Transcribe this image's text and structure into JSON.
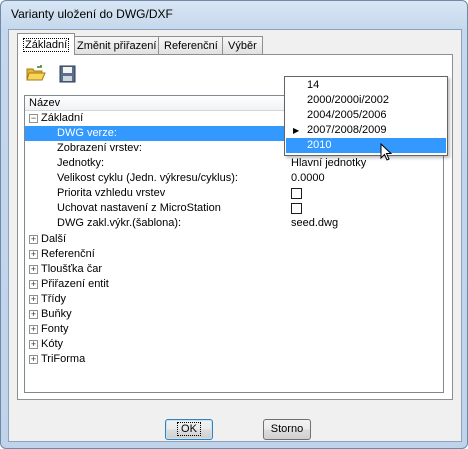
{
  "window": {
    "title": "Varianty uložení do DWG/DXF"
  },
  "tabs": [
    {
      "label": "Základní"
    },
    {
      "label": "Změnit přiřazení"
    },
    {
      "label": "Referenční"
    },
    {
      "label": "Výběr"
    }
  ],
  "toolbar": {
    "open_icon": "folder-open-icon",
    "save_icon": "floppy-save-icon"
  },
  "grid": {
    "header": "Název",
    "section_basic": "Základní",
    "rows": [
      {
        "label": "DWG verze:",
        "value": ""
      },
      {
        "label": "Zobrazení vrstev:",
        "value": ""
      },
      {
        "label": "Jednotky:",
        "value": "Hlavní jednotky"
      },
      {
        "label": "Velikost cyklu (Jedn. výkresu/cyklus):",
        "value": "0.0000"
      },
      {
        "label": "Priorita vzhledu vrstev",
        "value": ""
      },
      {
        "label": "Uchovat nastavení z MicroStation",
        "value": ""
      },
      {
        "label": "DWG zakl.výkr.(šablona):",
        "value": "seed.dwg"
      }
    ],
    "groups": [
      "Další",
      "Referenční",
      "Tloušťka čar",
      "Přiřazení entit",
      "Třídy",
      "Buňky",
      "Fonty",
      "Kóty",
      "TriForma"
    ]
  },
  "dropdown": {
    "options": [
      "14",
      "2000/2000i/2002",
      "2004/2005/2006",
      "2007/2008/2009",
      "2010"
    ],
    "selected": "2010",
    "current": "2007/2008/2009"
  },
  "buttons": {
    "ok": "OK",
    "cancel": "Storno"
  },
  "colors": {
    "selection": "#3399ff"
  }
}
